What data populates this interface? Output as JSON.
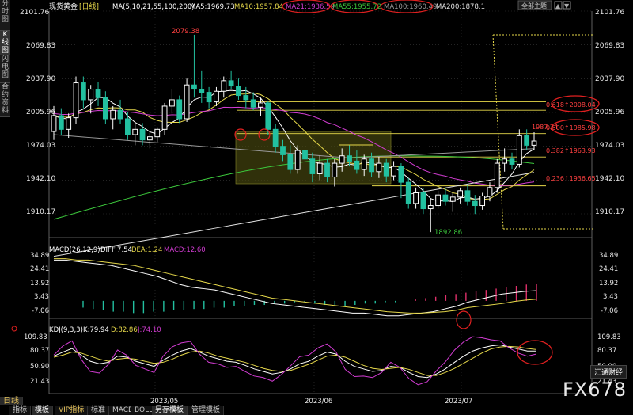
{
  "header": {
    "symbol": "现货黄金",
    "period_tag": "[日线]",
    "ma_label": "MA(5,10,21,55,100,200)",
    "ma5": "MA5:1969.73",
    "ma10": "MA10:1957.84",
    "ma21": "MA21:1936.59",
    "ma55": "MA55:1955.72",
    "ma100": "MA100:1960.49",
    "ma200": "MA200:1878.1",
    "theme_button": "全部主题",
    "ma5_color": "#ffffff",
    "ma10_color": "#e6d84a",
    "ma21_color": "#d23cd2",
    "ma55_color": "#3cc83c",
    "ma100_color": "#9a9a9a",
    "ma200_color": "#e0e0e0"
  },
  "sidebar": {
    "items": [
      "分时图",
      "K线图",
      "闪电图",
      "合约资料"
    ]
  },
  "price_axis": {
    "labels": [
      "2101.76",
      "2069.83",
      "2037.90",
      "2005.96",
      "1974.03",
      "1942.10",
      "1910.17"
    ],
    "values": [
      2101.76,
      2069.83,
      2037.9,
      2005.96,
      1974.03,
      1942.1,
      1910.17
    ]
  },
  "macd": {
    "label": "MACD(26,12,9)",
    "diff": "DIFF:7.54",
    "dea": "DEA:1.24",
    "macd": "MACD:12.60",
    "axis": [
      "34.89",
      "24.41",
      "13.92",
      "3.43",
      "-7.06"
    ],
    "values": [
      34.89,
      24.41,
      13.92,
      3.43,
      -7.06
    ]
  },
  "kdj": {
    "label": "KDJ(9,3,3)",
    "k": "K:79.94",
    "d": "D:82.86",
    "j": "J:74.10",
    "axis": [
      "109.83",
      "80.37",
      "50.90",
      "21.43"
    ],
    "values": [
      109.83,
      80.37,
      50.9,
      21.43
    ]
  },
  "time_axis": [
    "2023/05",
    "2023/06",
    "2023/07"
  ],
  "annotations": {
    "high": "2079.38",
    "low": "1892.86",
    "fib_0618": "0.618↑2008.04",
    "fib_0500": "0.500↑1985.98",
    "fib_0382": "0.382↑1963.93",
    "fib_0236": "0.236↑1936.65",
    "last_price": "1987.24"
  },
  "tabs": {
    "period": "日线",
    "items": [
      "指标",
      "模板",
      "VIP指标",
      "标准",
      "MACD",
      "BOLL",
      "另存模板",
      "管理模板"
    ]
  },
  "watermark": "FX678",
  "watermark_box": "汇通财经",
  "chart_data": [
    {
      "type": "candlestick",
      "title": "现货黄金 [日线]",
      "ylim": [
        1880,
        2105
      ],
      "y_ticks": [
        2101.76,
        2069.83,
        2037.9,
        2005.96,
        1974.03,
        1942.1,
        1910.17
      ],
      "x_ticks": [
        "2023/05",
        "2023/06",
        "2023/07"
      ],
      "ohlc": [
        [
          1988,
          2012,
          1980,
          2003
        ],
        [
          2003,
          2010,
          1985,
          1990
        ],
        [
          1990,
          2005,
          1982,
          2001
        ],
        [
          2001,
          2040,
          1995,
          2034
        ],
        [
          2034,
          2040,
          2010,
          2018
        ],
        [
          2018,
          2032,
          2005,
          2028
        ],
        [
          2028,
          2035,
          2012,
          2020
        ],
        [
          2020,
          2026,
          1995,
          2000
        ],
        [
          2000,
          2012,
          1990,
          2008
        ],
        [
          2008,
          2018,
          1995,
          2000
        ],
        [
          2000,
          2006,
          1980,
          1985
        ],
        [
          1985,
          1997,
          1975,
          1990
        ],
        [
          1990,
          1996,
          1975,
          1980
        ],
        [
          1980,
          1987,
          1972,
          1983
        ],
        [
          1983,
          1992,
          1978,
          1990
        ],
        [
          1990,
          2015,
          1985,
          2012
        ],
        [
          2012,
          2028,
          2005,
          2018
        ],
        [
          2018,
          2022,
          1996,
          2000
        ],
        [
          2000,
          2038,
          1997,
          2032
        ],
        [
          2032,
          2079.38,
          2020,
          2028
        ],
        [
          2028,
          2045,
          2015,
          2025
        ],
        [
          2025,
          2030,
          2010,
          2016
        ],
        [
          2016,
          2030,
          2012,
          2026
        ],
        [
          2026,
          2040,
          2020,
          2036
        ],
        [
          2036,
          2045,
          2028,
          2031
        ],
        [
          2031,
          2038,
          2018,
          2022
        ],
        [
          2022,
          2030,
          2010,
          2018
        ],
        [
          2018,
          2025,
          2008,
          2011
        ],
        [
          2011,
          2020,
          2003,
          2015
        ],
        [
          2015,
          2017,
          1985,
          1990
        ],
        [
          1990,
          1995,
          1968,
          1974
        ],
        [
          1974,
          1980,
          1960,
          1966
        ],
        [
          1966,
          1975,
          1948,
          1952
        ],
        [
          1952,
          1975,
          1948,
          1970
        ],
        [
          1970,
          1980,
          1955,
          1962
        ],
        [
          1962,
          1968,
          1940,
          1948
        ],
        [
          1948,
          1965,
          1942,
          1958
        ],
        [
          1958,
          1962,
          1940,
          1945
        ],
        [
          1945,
          1962,
          1936,
          1958
        ],
        [
          1958,
          1972,
          1950,
          1965
        ],
        [
          1965,
          1975,
          1955,
          1960
        ],
        [
          1960,
          1970,
          1948,
          1952
        ],
        [
          1952,
          1966,
          1946,
          1962
        ],
        [
          1962,
          1968,
          1945,
          1950
        ],
        [
          1950,
          1964,
          1944,
          1958
        ],
        [
          1958,
          1962,
          1940,
          1946
        ],
        [
          1946,
          1960,
          1942,
          1955
        ],
        [
          1955,
          1958,
          1925,
          1940
        ],
        [
          1940,
          1944,
          1915,
          1920
        ],
        [
          1920,
          1935,
          1915,
          1930
        ],
        [
          1930,
          1934,
          1910,
          1915
        ],
        [
          1915,
          1925,
          1892.86,
          1918
        ],
        [
          1918,
          1932,
          1915,
          1928
        ],
        [
          1928,
          1935,
          1918,
          1922
        ],
        [
          1922,
          1930,
          1912,
          1926
        ],
        [
          1926,
          1935,
          1920,
          1932
        ],
        [
          1932,
          1938,
          1918,
          1922
        ],
        [
          1922,
          1928,
          1910,
          1918
        ],
        [
          1918,
          1930,
          1914,
          1927
        ],
        [
          1927,
          1940,
          1922,
          1935
        ],
        [
          1935,
          1962,
          1930,
          1958
        ],
        [
          1958,
          1972,
          1950,
          1962
        ],
        [
          1962,
          1968,
          1952,
          1957
        ],
        [
          1957,
          1990,
          1954,
          1984
        ],
        [
          1984,
          1990,
          1970,
          1975
        ],
        [
          1975,
          1987.24,
          1970,
          1979
        ]
      ],
      "fib_levels": [
        {
          "label": "0.618",
          "value": 2008.04
        },
        {
          "label": "0.500",
          "value": 1985.98
        },
        {
          "label": "0.382",
          "value": 1963.93
        },
        {
          "label": "0.236",
          "value": 1936.65
        }
      ],
      "marked_points": [
        {
          "label": "2079.38",
          "value": 2079.38
        },
        {
          "label": "1892.86",
          "value": 1892.86
        },
        {
          "label": "1987.24",
          "value": 1987.24
        }
      ]
    },
    {
      "type": "bar",
      "title": "MACD(26,12,9)",
      "ylim": [
        -12,
        37
      ],
      "y_ticks": [
        34.89,
        24.41,
        13.92,
        3.43,
        -7.06
      ],
      "series": [
        {
          "name": "DIFF",
          "color": "#ffffff",
          "values": [
            30,
            30,
            29,
            28,
            27,
            26,
            24,
            22,
            20,
            18,
            15,
            12,
            10,
            9,
            8,
            6,
            4,
            2,
            0,
            -2,
            -3,
            -4,
            -5,
            -6,
            -7,
            -8,
            -9,
            -9,
            -10,
            -11,
            -11,
            -10,
            -9,
            -8,
            -6,
            -4,
            -1,
            1,
            3,
            5,
            6,
            7,
            7.54
          ]
        },
        {
          "name": "DEA",
          "color": "#e6d84a",
          "values": [
            31,
            31,
            30,
            30,
            29,
            28,
            27,
            26,
            24,
            22,
            20,
            18,
            16,
            14,
            12,
            10,
            8,
            6,
            4,
            2,
            1,
            0,
            -1,
            -2,
            -3,
            -4,
            -5,
            -6,
            -7,
            -8,
            -8.5,
            -9,
            -9,
            -8.5,
            -8,
            -7,
            -5,
            -4,
            -3,
            -2,
            -0.5,
            0.5,
            1.24
          ]
        }
      ],
      "histogram": [
        -5,
        -6,
        -7,
        -8,
        -8,
        -9,
        -9,
        -8,
        -8,
        -7,
        -7,
        -6,
        -6,
        -5,
        -5,
        -4,
        -4,
        -3,
        -3,
        -2,
        -2,
        -1,
        -1,
        -2,
        -3,
        -3,
        -4,
        -3,
        -2,
        -2,
        -1,
        -1,
        0,
        1,
        2,
        3,
        4,
        5,
        6,
        7,
        8,
        9,
        10,
        11,
        12,
        12.6
      ]
    },
    {
      "type": "line",
      "title": "KDJ(9,3,3)",
      "ylim": [
        5,
        120
      ],
      "y_ticks": [
        109.83,
        80.37,
        50.9,
        21.43
      ],
      "series": [
        {
          "name": "K",
          "color": "#ffffff",
          "values": [
            70,
            78,
            85,
            72,
            60,
            55,
            58,
            70,
            68,
            60,
            55,
            50,
            62,
            72,
            80,
            85,
            78,
            70,
            65,
            60,
            58,
            52,
            45,
            40,
            35,
            38,
            45,
            55,
            60,
            70,
            78,
            74,
            60,
            50,
            45,
            40,
            42,
            50,
            48,
            38,
            30,
            28,
            35,
            45,
            58,
            70,
            80,
            86,
            90,
            92,
            88,
            84,
            80,
            79.94
          ]
        },
        {
          "name": "D",
          "color": "#e6d84a",
          "values": [
            68,
            72,
            78,
            76,
            70,
            64,
            60,
            64,
            66,
            64,
            60,
            56,
            58,
            64,
            72,
            78,
            80,
            76,
            70,
            66,
            62,
            58,
            52,
            46,
            42,
            40,
            42,
            48,
            54,
            62,
            70,
            72,
            68,
            60,
            52,
            46,
            44,
            46,
            48,
            44,
            38,
            32,
            32,
            38,
            46,
            56,
            66,
            76,
            84,
            88,
            89,
            88,
            85,
            82.86
          ]
        },
        {
          "name": "J",
          "color": "#d23cd2",
          "values": [
            72,
            90,
            100,
            64,
            40,
            37,
            54,
            82,
            72,
            52,
            45,
            38,
            70,
            88,
            96,
            99,
            74,
            58,
            55,
            48,
            50,
            40,
            31,
            28,
            21,
            34,
            51,
            69,
            72,
            86,
            94,
            78,
            44,
            30,
            31,
            28,
            38,
            58,
            48,
            26,
            14,
            20,
            41,
            59,
            82,
            98,
            108,
            106,
            102,
            100,
            86,
            76,
            70,
            74.1
          ]
        }
      ]
    }
  ]
}
